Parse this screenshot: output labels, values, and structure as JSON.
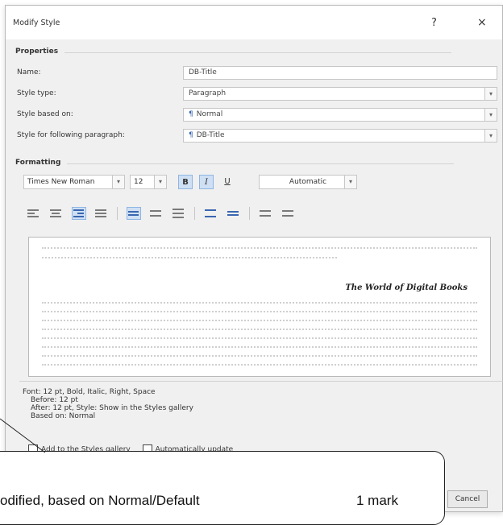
{
  "dialog": {
    "title": "Modify Style",
    "help_label": "?",
    "close_label": "×"
  },
  "properties": {
    "heading": "Properties",
    "name_label": "Name:",
    "name_value": "DB-Title",
    "style_type_label": "Style type:",
    "style_type_value": "Paragraph",
    "based_on_label": "Style based on:",
    "based_on_value": "Normal",
    "following_label": "Style for following paragraph:",
    "following_value": "DB-Title"
  },
  "formatting": {
    "heading": "Formatting",
    "font_value": "Times New Roman",
    "size_value": "12",
    "bold_label": "B",
    "italic_label": "I",
    "underline_label": "U",
    "color_value": "Automatic"
  },
  "preview": {
    "sample_text": "The World of Digital Books"
  },
  "description": {
    "line1": "Font: 12 pt, Bold, Italic, Right, Space",
    "line2": "Before: 12 pt",
    "line3": "After: 12 pt, Style: Show in the Styles gallery",
    "line4": "Based on: Normal"
  },
  "options": {
    "add_to_gallery_label": "Add to the Styles gallery",
    "auto_update_label": "Automatically update"
  },
  "buttons": {
    "cancel_label": "Cancel"
  },
  "annotation": {
    "text": "odified, based on Normal/Default",
    "marks": "1 mark"
  },
  "icons": {
    "paragraph": "pilcrow-icon",
    "dropdown": "chevron-down-icon"
  },
  "colors": {
    "accent": "#3a66b0",
    "active_bg": "#cfe0f4"
  }
}
